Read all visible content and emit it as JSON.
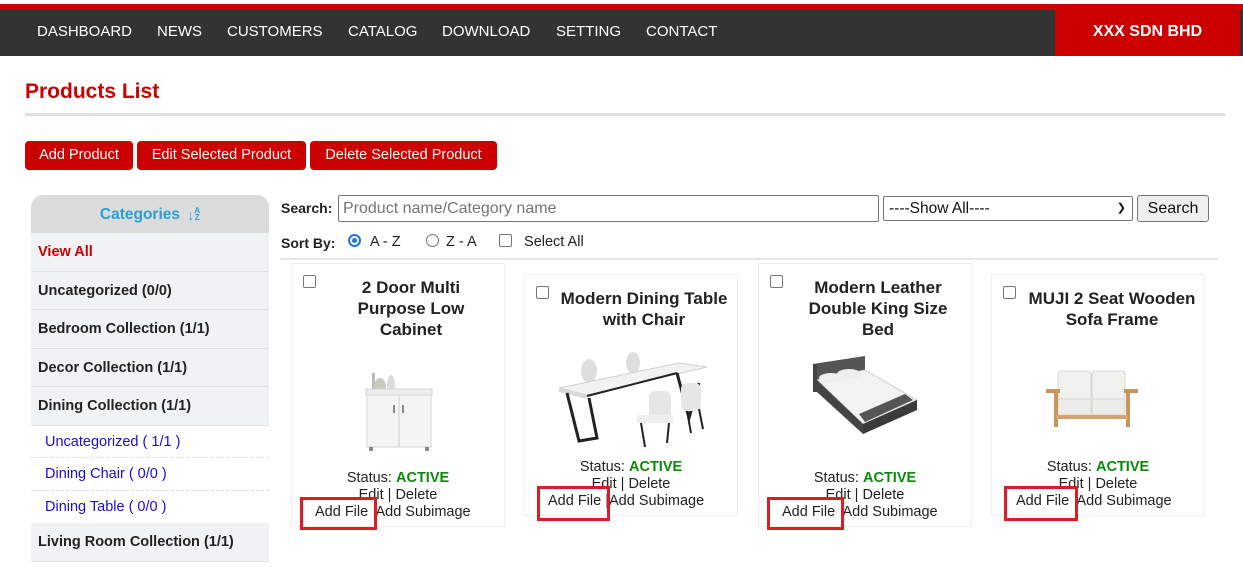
{
  "nav": {
    "items": [
      "DASHBOARD",
      "NEWS",
      "CUSTOMERS",
      "CATALOG",
      "DOWNLOAD",
      "SETTING",
      "CONTACT"
    ],
    "brand": "XXX SDN BHD"
  },
  "page": {
    "title": "Products List",
    "actions": {
      "add": "Add Product",
      "edit": "Edit Selected Product",
      "delete": "Delete Selected Product"
    }
  },
  "sidebar": {
    "header": "Categories",
    "sort_icon": "sort-alpha-down-icon",
    "az_top": "A",
    "az_bottom": "Z",
    "view_all": "View All",
    "categories": [
      {
        "label": "Uncategorized (0/0)"
      },
      {
        "label": "Bedroom Collection (1/1)"
      },
      {
        "label": "Decor Collection (1/1)"
      },
      {
        "label": "Dining Collection (1/1)"
      }
    ],
    "subcategories": [
      {
        "label": "Uncategorized ( 1/1 )"
      },
      {
        "label": "Dining Chair ( 0/0 )"
      },
      {
        "label": "Dining Table ( 0/0 )"
      }
    ],
    "after": [
      {
        "label": "Living Room Collection (1/1)"
      }
    ]
  },
  "search": {
    "label": "Search:",
    "placeholder": "Product name/Category name",
    "value": "",
    "filter_selected": "----Show All----",
    "button": "Search"
  },
  "sort": {
    "label": "Sort By:",
    "asc": "A - Z",
    "desc": "Z - A",
    "selected": "A - Z",
    "select_all": "Select All"
  },
  "products": [
    {
      "name": "2 Door Multi Purpose Low Cabinet",
      "status_label": "Status:",
      "status": "ACTIVE",
      "edit": "Edit",
      "delete": "Delete",
      "add_file": "Add File",
      "add_subimage": "Add Subimage",
      "image": "cabinet-image"
    },
    {
      "name": "Modern Dining Table with Chair",
      "status_label": "Status:",
      "status": "ACTIVE",
      "edit": "Edit",
      "delete": "Delete",
      "add_file": "Add File",
      "add_subimage": "Add Subimage",
      "image": "dining-table-image"
    },
    {
      "name": "Modern Leather Double King Size Bed",
      "status_label": "Status:",
      "status": "ACTIVE",
      "edit": "Edit",
      "delete": "Delete",
      "add_file": "Add File",
      "add_subimage": "Add Subimage",
      "image": "bed-image"
    },
    {
      "name": "MUJI 2 Seat Wooden Sofa Frame",
      "status_label": "Status:",
      "status": "ACTIVE",
      "edit": "Edit",
      "delete": "Delete",
      "add_file": "Add File",
      "add_subimage": "Add Subimage",
      "image": "sofa-image"
    }
  ],
  "separator": "|",
  "colors": {
    "brand_red": "#cc0000",
    "nav_bg": "#333333",
    "status_active": "#0a8a0a",
    "category_header": "#2a9fd6",
    "sub_link": "#1a0dcc",
    "highlight": "#e01b24"
  }
}
